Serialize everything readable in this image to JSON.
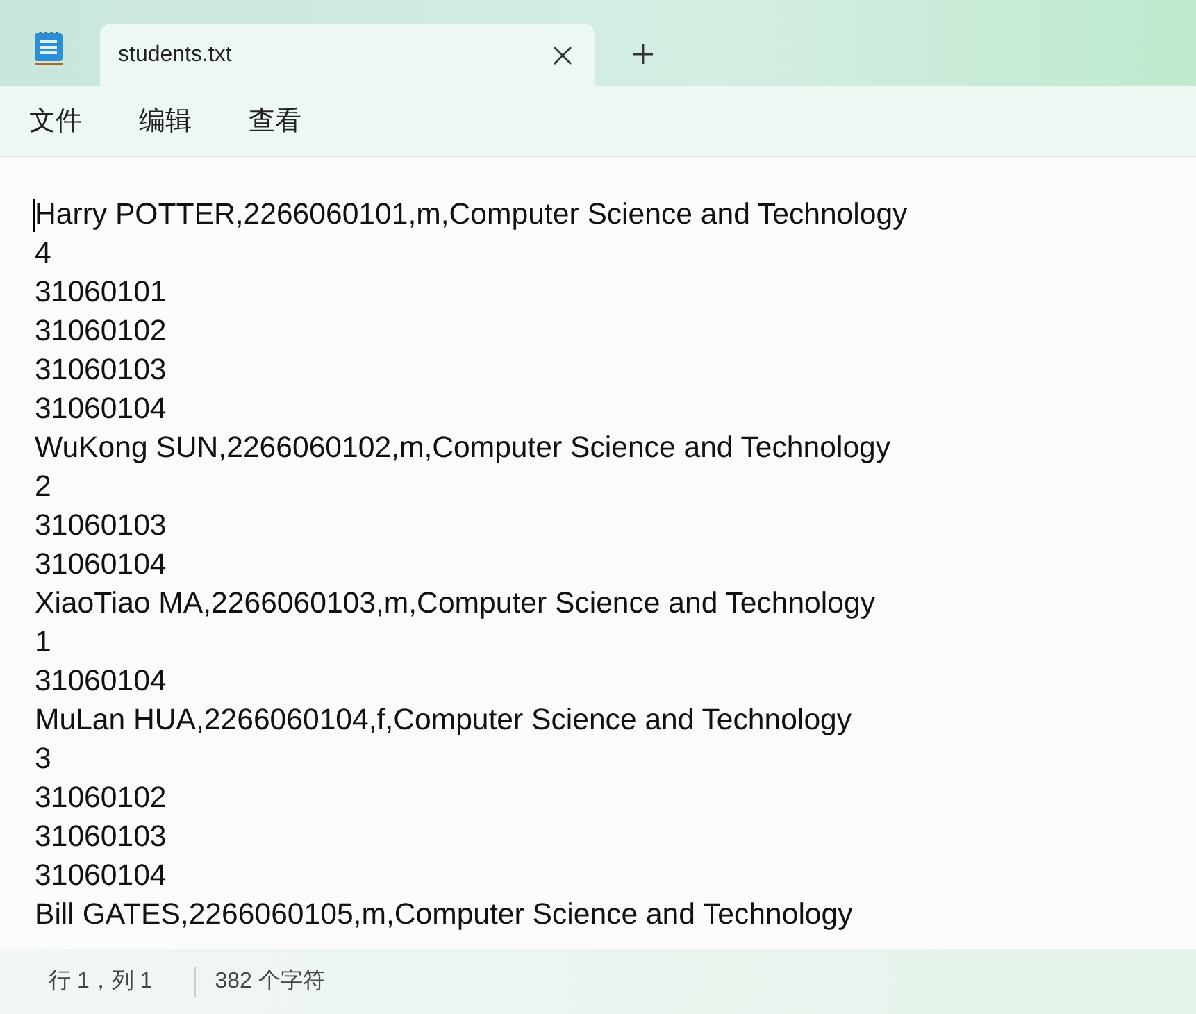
{
  "window": {
    "tab": {
      "title": "students.txt",
      "selected": true
    }
  },
  "menu": [
    "文件",
    "编辑",
    "查看"
  ],
  "editor": {
    "lines": [
      "Harry POTTER,2266060101,m,Computer Science and Technology",
      "4",
      "31060101",
      "31060102",
      "31060103",
      "31060104",
      "WuKong SUN,2266060102,m,Computer Science and Technology",
      "2",
      "31060103",
      "31060104",
      "XiaoTiao MA,2266060103,m,Computer Science and Technology",
      "1",
      "31060104",
      "MuLan HUA,2266060104,f,Computer Science and Technology",
      "3",
      "31060102",
      "31060103",
      "31060104",
      "Bill GATES,2266060105,m,Computer Science and Technology"
    ]
  },
  "status_bar": {
    "position": "行 1，列 1",
    "count": "382 个字符"
  }
}
